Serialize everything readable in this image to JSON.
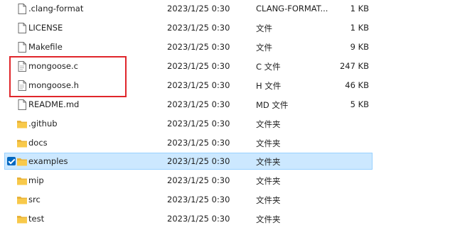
{
  "colors": {
    "selection_background": "#cce8ff",
    "selection_border": "#99d1ff",
    "checkbox_accent": "#0067c0",
    "highlight_box": "#e0262b",
    "folder_yellow": "#f8c94a"
  },
  "files": [
    {
      "name": ".clang-format",
      "date": "2023/1/25 0:30",
      "type": "CLANG-FORMAT...",
      "size": "1 KB",
      "icon": "file-icon",
      "selected": false
    },
    {
      "name": "LICENSE",
      "date": "2023/1/25 0:30",
      "type": "文件",
      "size": "1 KB",
      "icon": "file-icon",
      "selected": false
    },
    {
      "name": "Makefile",
      "date": "2023/1/25 0:30",
      "type": "文件",
      "size": "9 KB",
      "icon": "file-icon",
      "selected": false
    },
    {
      "name": "mongoose.c",
      "date": "2023/1/25 0:30",
      "type": "C 文件",
      "size": "247 KB",
      "icon": "file-icon",
      "selected": false
    },
    {
      "name": "mongoose.h",
      "date": "2023/1/25 0:30",
      "type": "H 文件",
      "size": "46 KB",
      "icon": "file-icon",
      "selected": false
    },
    {
      "name": "README.md",
      "date": "2023/1/25 0:30",
      "type": "MD 文件",
      "size": "5 KB",
      "icon": "file-icon",
      "selected": false
    },
    {
      "name": ".github",
      "date": "2023/1/25 0:30",
      "type": "文件夹",
      "size": "",
      "icon": "folder-icon",
      "selected": false
    },
    {
      "name": "docs",
      "date": "2023/1/25 0:30",
      "type": "文件夹",
      "size": "",
      "icon": "folder-icon",
      "selected": false
    },
    {
      "name": "examples",
      "date": "2023/1/25 0:30",
      "type": "文件夹",
      "size": "",
      "icon": "folder-icon",
      "selected": true
    },
    {
      "name": "mip",
      "date": "2023/1/25 0:30",
      "type": "文件夹",
      "size": "",
      "icon": "folder-icon",
      "selected": false
    },
    {
      "name": "src",
      "date": "2023/1/25 0:30",
      "type": "文件夹",
      "size": "",
      "icon": "folder-icon",
      "selected": false
    },
    {
      "name": "test",
      "date": "2023/1/25 0:30",
      "type": "文件夹",
      "size": "",
      "icon": "folder-icon",
      "selected": false
    }
  ]
}
